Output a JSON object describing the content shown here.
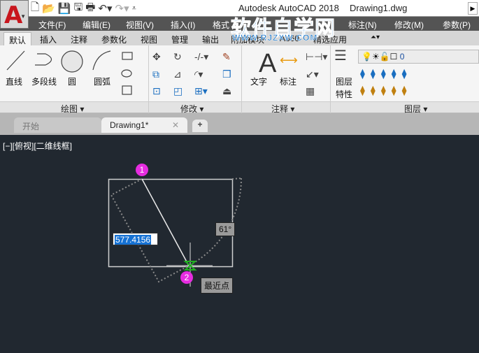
{
  "app": {
    "logo_letter": "A",
    "title": "Autodesk AutoCAD 2018",
    "document": "Drawing1.dwg"
  },
  "quick_access": [
    "new-icon",
    "open-icon",
    "save-icon",
    "save-as-icon",
    "plot-icon",
    "undo-icon",
    "redo-icon",
    "customize-icon"
  ],
  "menu": [
    "文件(F)",
    "编辑(E)",
    "视图(V)",
    "插入(I)",
    "格式",
    "标注(N)",
    "修改(M)",
    "参数(P)"
  ],
  "ribbon_tabs": [
    "默认",
    "插入",
    "注释",
    "参数化",
    "视图",
    "管理",
    "输出",
    "附加模块",
    "A360",
    "精选应用"
  ],
  "panels": {
    "draw": {
      "label": "绘图",
      "tools": [
        "直线",
        "多段线",
        "圆",
        "圆弧"
      ]
    },
    "modify": {
      "label": "修改"
    },
    "annotation": {
      "label": "注释",
      "tools": [
        "文字",
        "标注"
      ]
    },
    "layers": {
      "label": "图层",
      "tool_line1": "图层",
      "tool_line2": "特性",
      "current_layer": "0"
    }
  },
  "doc_tabs": [
    {
      "label": "开始"
    },
    {
      "label": "Drawing1*",
      "active": true
    }
  ],
  "viewport_label": "[−][俯视][二维线框]",
  "drawing": {
    "input_value": "577.4156",
    "angle": "61°",
    "snap_tooltip": "最近点",
    "marker1": "1",
    "marker2": "2"
  },
  "watermark": {
    "line1": "软件自学网",
    "line2": "WWW.RJZXW.COM"
  },
  "colors": {
    "canvas": "#212830",
    "marker": "#e62ce0",
    "snap": "#21b021",
    "highlight": "#1672d4"
  }
}
